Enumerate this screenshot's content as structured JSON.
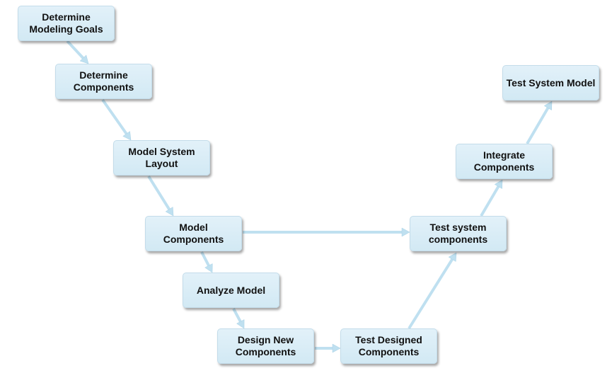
{
  "diagram": {
    "nodes": [
      {
        "id": "goals",
        "label": "Determine Modeling Goals"
      },
      {
        "id": "components",
        "label": "Determine Components"
      },
      {
        "id": "layout",
        "label": "Model System Layout"
      },
      {
        "id": "model",
        "label": "Model Components"
      },
      {
        "id": "analyze",
        "label": "Analyze Model"
      },
      {
        "id": "design",
        "label": "Design New Components"
      },
      {
        "id": "testdesigned",
        "label": "Test Designed Components"
      },
      {
        "id": "testsys",
        "label": "Test system components"
      },
      {
        "id": "integrate",
        "label": "Integrate Components"
      },
      {
        "id": "testmodel",
        "label": "Test System Model"
      }
    ],
    "edges": [
      [
        "goals",
        "components"
      ],
      [
        "components",
        "layout"
      ],
      [
        "layout",
        "model"
      ],
      [
        "model",
        "testsys"
      ],
      [
        "model",
        "analyze"
      ],
      [
        "analyze",
        "design"
      ],
      [
        "design",
        "testdesigned"
      ],
      [
        "testdesigned",
        "testsys"
      ],
      [
        "testsys",
        "integrate"
      ],
      [
        "integrate",
        "testmodel"
      ]
    ],
    "colors": {
      "node_fill": "#d6ebf5",
      "arrow": "#bfe0f0"
    }
  }
}
